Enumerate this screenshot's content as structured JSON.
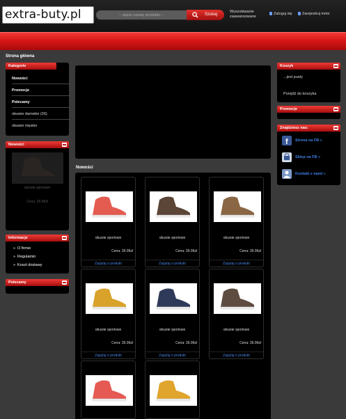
{
  "header": {
    "logo": "extra-buty.pl",
    "search_placeholder": "-- wpisz nazwę produktu --",
    "search_button": "Szukaj",
    "advanced_search": "Wyszukiwanie zaawansowane",
    "login": "Zaloguj się",
    "register": "Zarejestruj mnie"
  },
  "breadcrumb": "Strona główna",
  "left": {
    "categories": {
      "title": "Kategorie",
      "items": [
        "Nowości",
        "Promocje",
        "Polecamy",
        "obuwie damskie (26)",
        "obuwie męskie"
      ]
    },
    "news": {
      "title": "Nowości",
      "product_name": "obuwie sportowe",
      "price": "Cena: 39.99zł"
    },
    "info": {
      "title": "Informacje",
      "items": [
        "O firmie",
        "Regulamin",
        "Koszt dostawy"
      ]
    },
    "recommended": {
      "title": "Polecamy"
    }
  },
  "center": {
    "section_title": "Nowości",
    "products": [
      {
        "name": "obuwie sportowe",
        "price": "Cena: 39.99zł",
        "ask": "Zapytaj o produkt",
        "color": "#e45b4f"
      },
      {
        "name": "obuwie sportowe",
        "price": "Cena: 39.99zł",
        "ask": "Zapytaj o produkt",
        "color": "#5a4536"
      },
      {
        "name": "obuwie sportowe",
        "price": "Cena: 39.99zł",
        "ask": "Zapytaj o produkt",
        "color": "#8a6644"
      },
      {
        "name": "obuwie sportowe",
        "price": "Cena: 39.99zł",
        "ask": "Zapytaj o produkt",
        "color": "#d9a22b"
      },
      {
        "name": "obuwie sportowe",
        "price": "Cena: 39.99zł",
        "ask": "Zapytaj o produkt",
        "color": "#2f3a5a"
      },
      {
        "name": "obuwie sportowe",
        "price": "Cena: 39.99zł",
        "ask": "Zapytaj o produkt",
        "color": "#5e4c40"
      },
      {
        "color": "#e55a52"
      },
      {
        "color": "#e0a52c"
      }
    ]
  },
  "right": {
    "cart": {
      "title": "Koszyk",
      "empty": "...jest pusty",
      "go": "Przejdź do koszyka"
    },
    "promo": {
      "title": "Promocje"
    },
    "find_us": {
      "title": "Znajdziesz nas:",
      "links": [
        {
          "label": "Strona na FB »",
          "icon": "facebook-icon",
          "color": "#3b5998"
        },
        {
          "label": "Sklep na FB »",
          "icon": "shop-icon",
          "color": "#cfd8e6"
        },
        {
          "label": "Kontakt z nami »",
          "icon": "contact-icon",
          "color": "#7d99c6"
        }
      ]
    }
  },
  "colors": {
    "accent": "#d81717",
    "link": "#4a86e8",
    "panel": "#000000",
    "page": "#3a3a3a"
  }
}
